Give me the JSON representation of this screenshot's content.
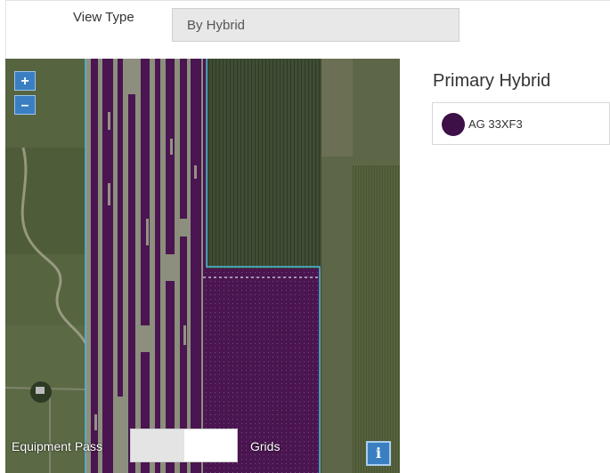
{
  "view_type": {
    "label": "View Type",
    "value": "By Hybrid"
  },
  "map": {
    "zoom_in": "+",
    "zoom_out": "–",
    "equipment_pass_label": "Equipment Pass",
    "grids_label": "Grids",
    "info": "i",
    "planted_color": "#4a1550"
  },
  "legend": {
    "title": "Primary Hybrid",
    "items": [
      {
        "name": "AG 33XF3",
        "color": "#3d1048"
      }
    ]
  }
}
